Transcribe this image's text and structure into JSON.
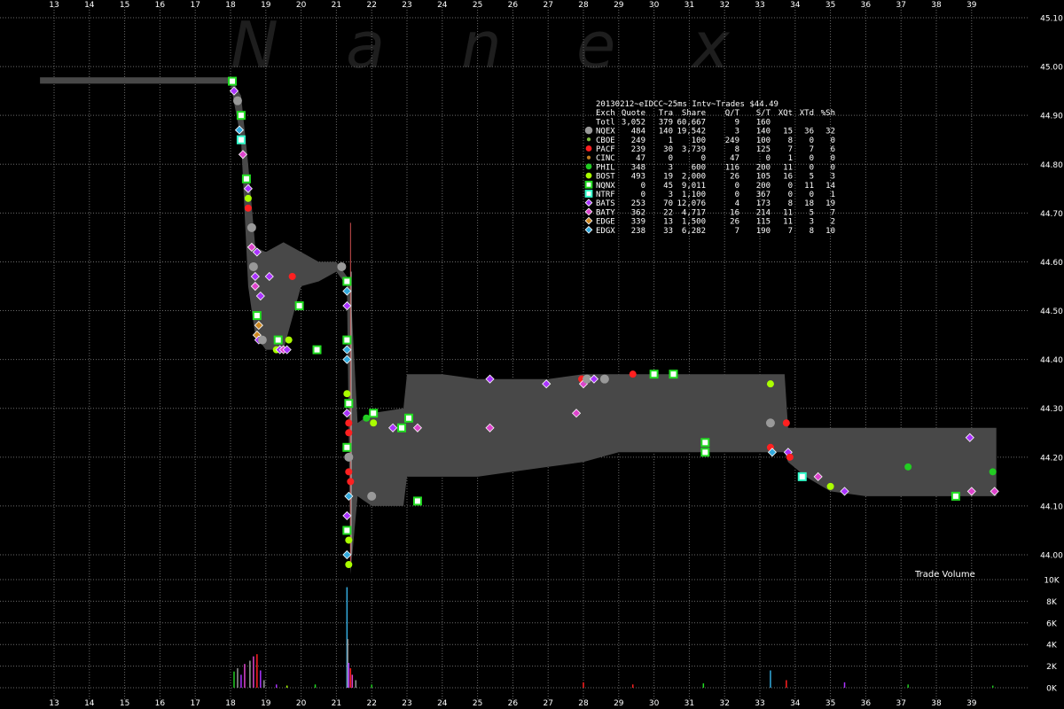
{
  "watermark": [
    "N",
    "a",
    "n",
    "e",
    "x"
  ],
  "legend": {
    "title": "20130212~eIDCC~25ms Intv~Trades $44.49",
    "header": [
      "Exch",
      "Quote",
      "Tra",
      "Share",
      "Q/T",
      "S/T",
      "XQt",
      "XTd",
      "%Sh"
    ],
    "total": [
      "Totl",
      "3,052",
      "379",
      "60,667",
      "9",
      "160",
      "",
      "",
      ""
    ],
    "rows": [
      {
        "name": "NQEX",
        "color": "#999999",
        "marker": "circle-large",
        "values": [
          "484",
          "140",
          "19,542",
          "3",
          "140",
          "15",
          "36",
          "32"
        ]
      },
      {
        "name": "CBOE",
        "color": "#7fbf3f",
        "marker": "circle-small",
        "values": [
          "249",
          "1",
          "100",
          "249",
          "100",
          "8",
          "0",
          "0"
        ]
      },
      {
        "name": "PACF",
        "color": "#ff2020",
        "marker": "circle",
        "values": [
          "239",
          "30",
          "3,739",
          "8",
          "125",
          "7",
          "7",
          "6"
        ]
      },
      {
        "name": "CINC",
        "color": "#c08020",
        "marker": "circle-small",
        "values": [
          "47",
          "0",
          "0",
          "47",
          "0",
          "1",
          "0",
          "0"
        ]
      },
      {
        "name": "PHIL",
        "color": "#22cc22",
        "marker": "circle",
        "values": [
          "348",
          "3",
          "600",
          "116",
          "200",
          "11",
          "0",
          "0"
        ]
      },
      {
        "name": "BOST",
        "color": "#aaff00",
        "marker": "circle",
        "values": [
          "493",
          "19",
          "2,000",
          "26",
          "105",
          "16",
          "5",
          "3"
        ]
      },
      {
        "name": "NQNX",
        "color": "#22dd22",
        "marker": "square",
        "values": [
          "0",
          "45",
          "9,011",
          "0",
          "200",
          "0",
          "11",
          "14"
        ]
      },
      {
        "name": "NTRF",
        "color": "#33ffcc",
        "marker": "square",
        "values": [
          "0",
          "3",
          "1,100",
          "0",
          "367",
          "0",
          "0",
          "1"
        ]
      },
      {
        "name": "BATS",
        "color": "#aa33ff",
        "marker": "diamond",
        "values": [
          "253",
          "70",
          "12,076",
          "4",
          "173",
          "8",
          "18",
          "19"
        ]
      },
      {
        "name": "BATY",
        "color": "#dd44cc",
        "marker": "diamond",
        "values": [
          "362",
          "22",
          "4,717",
          "16",
          "214",
          "11",
          "5",
          "7"
        ]
      },
      {
        "name": "EDGE",
        "color": "#cc8822",
        "marker": "diamond",
        "values": [
          "339",
          "13",
          "1,500",
          "26",
          "115",
          "11",
          "3",
          "2"
        ]
      },
      {
        "name": "EDGX",
        "color": "#33aadd",
        "marker": "diamond",
        "values": [
          "238",
          "33",
          "6,282",
          "7",
          "190",
          "7",
          "8",
          "10"
        ]
      }
    ]
  },
  "volume_label": "Trade Volume",
  "chart_data": {
    "type": "scatter",
    "x_ticks": [
      "13",
      "14",
      "15",
      "16",
      "17",
      "18",
      "19",
      "20",
      "21",
      "22",
      "23",
      "24",
      "25",
      "26",
      "27",
      "28",
      "29",
      "30",
      "31",
      "32",
      "33",
      "34",
      "35",
      "36",
      "37",
      "38",
      "39"
    ],
    "price_ticks": [
      "45.10",
      "45.00",
      "44.90",
      "44.80",
      "44.70",
      "44.60",
      "44.50",
      "44.40",
      "44.30",
      "44.20",
      "44.10",
      "44.00"
    ],
    "volume_ticks": [
      "10K",
      "8K",
      "6K",
      "4K",
      "2K",
      "0K"
    ],
    "ylim_price": [
      43.97,
      45.12
    ],
    "ylim_volume": [
      0,
      10000
    ],
    "grid": true,
    "spread_band": [
      {
        "x": 12.6,
        "bid": 44.965,
        "ask": 44.978
      },
      {
        "x": 18.0,
        "bid": 44.965,
        "ask": 44.978
      },
      {
        "x": 18.3,
        "bid": 44.85,
        "ask": 44.94
      },
      {
        "x": 18.5,
        "bid": 44.55,
        "ask": 44.8
      },
      {
        "x": 18.7,
        "bid": 44.45,
        "ask": 44.63
      },
      {
        "x": 19.0,
        "bid": 44.42,
        "ask": 44.62
      },
      {
        "x": 19.5,
        "bid": 44.42,
        "ask": 44.64
      },
      {
        "x": 20.0,
        "bid": 44.55,
        "ask": 44.62
      },
      {
        "x": 20.5,
        "bid": 44.56,
        "ask": 44.6
      },
      {
        "x": 21.0,
        "bid": 44.58,
        "ask": 44.6
      },
      {
        "x": 21.3,
        "bid": 44.55,
        "ask": 44.57
      },
      {
        "x": 21.4,
        "bid": 43.96,
        "ask": 44.55
      },
      {
        "x": 21.6,
        "bid": 44.12,
        "ask": 44.27
      },
      {
        "x": 22.0,
        "bid": 44.1,
        "ask": 44.29
      },
      {
        "x": 22.9,
        "bid": 44.1,
        "ask": 44.3
      },
      {
        "x": 23.0,
        "bid": 44.16,
        "ask": 44.37
      },
      {
        "x": 24.0,
        "bid": 44.16,
        "ask": 44.37
      },
      {
        "x": 25.0,
        "bid": 44.16,
        "ask": 44.36
      },
      {
        "x": 26.0,
        "bid": 44.17,
        "ask": 44.36
      },
      {
        "x": 27.0,
        "bid": 44.18,
        "ask": 44.36
      },
      {
        "x": 28.0,
        "bid": 44.19,
        "ask": 44.37
      },
      {
        "x": 28.5,
        "bid": 44.2,
        "ask": 44.37
      },
      {
        "x": 29.0,
        "bid": 44.21,
        "ask": 44.37
      },
      {
        "x": 30.0,
        "bid": 44.21,
        "ask": 44.37
      },
      {
        "x": 31.0,
        "bid": 44.21,
        "ask": 44.37
      },
      {
        "x": 32.0,
        "bid": 44.21,
        "ask": 44.37
      },
      {
        "x": 33.0,
        "bid": 44.21,
        "ask": 44.37
      },
      {
        "x": 33.7,
        "bid": 44.21,
        "ask": 44.37
      },
      {
        "x": 33.8,
        "bid": 44.19,
        "ask": 44.26
      },
      {
        "x": 34.3,
        "bid": 44.16,
        "ask": 44.26
      },
      {
        "x": 35.0,
        "bid": 44.13,
        "ask": 44.26
      },
      {
        "x": 36.0,
        "bid": 44.12,
        "ask": 44.26
      },
      {
        "x": 37.0,
        "bid": 44.12,
        "ask": 44.26
      },
      {
        "x": 38.0,
        "bid": 44.12,
        "ask": 44.26
      },
      {
        "x": 39.7,
        "bid": 44.12,
        "ask": 44.26
      }
    ],
    "trades": [
      {
        "x": 18.05,
        "y": 44.97,
        "ex": "NQNX"
      },
      {
        "x": 18.1,
        "y": 44.95,
        "ex": "BATS"
      },
      {
        "x": 18.2,
        "y": 44.93,
        "ex": "NQEX"
      },
      {
        "x": 18.3,
        "y": 44.9,
        "ex": "NQNX"
      },
      {
        "x": 18.25,
        "y": 44.87,
        "ex": "EDGX"
      },
      {
        "x": 18.3,
        "y": 44.85,
        "ex": "NTRF"
      },
      {
        "x": 18.35,
        "y": 44.82,
        "ex": "BATY"
      },
      {
        "x": 18.45,
        "y": 44.77,
        "ex": "NQNX"
      },
      {
        "x": 18.5,
        "y": 44.75,
        "ex": "BATS"
      },
      {
        "x": 18.5,
        "y": 44.73,
        "ex": "BOST"
      },
      {
        "x": 18.5,
        "y": 44.71,
        "ex": "PACF"
      },
      {
        "x": 18.6,
        "y": 44.67,
        "ex": "NQEX"
      },
      {
        "x": 18.6,
        "y": 44.63,
        "ex": "BATY"
      },
      {
        "x": 18.75,
        "y": 44.62,
        "ex": "BATS"
      },
      {
        "x": 18.65,
        "y": 44.59,
        "ex": "NQEX"
      },
      {
        "x": 18.7,
        "y": 44.57,
        "ex": "BATS"
      },
      {
        "x": 18.7,
        "y": 44.55,
        "ex": "BATY"
      },
      {
        "x": 18.85,
        "y": 44.53,
        "ex": "BATS"
      },
      {
        "x": 18.75,
        "y": 44.49,
        "ex": "NQNX"
      },
      {
        "x": 18.8,
        "y": 44.47,
        "ex": "EDGE"
      },
      {
        "x": 18.75,
        "y": 44.45,
        "ex": "EDGE"
      },
      {
        "x": 18.8,
        "y": 44.44,
        "ex": "BATS"
      },
      {
        "x": 18.9,
        "y": 44.44,
        "ex": "NQEX"
      },
      {
        "x": 19.35,
        "y": 44.44,
        "ex": "NQNX"
      },
      {
        "x": 19.65,
        "y": 44.44,
        "ex": "BOST"
      },
      {
        "x": 19.3,
        "y": 44.42,
        "ex": "BOST"
      },
      {
        "x": 19.4,
        "y": 44.42,
        "ex": "BATS"
      },
      {
        "x": 19.5,
        "y": 44.42,
        "ex": "BATY"
      },
      {
        "x": 19.6,
        "y": 44.42,
        "ex": "BATS"
      },
      {
        "x": 19.75,
        "y": 44.57,
        "ex": "PACF"
      },
      {
        "x": 19.95,
        "y": 44.51,
        "ex": "NQNX"
      },
      {
        "x": 19.1,
        "y": 44.57,
        "ex": "BATS"
      },
      {
        "x": 20.45,
        "y": 44.42,
        "ex": "NQNX"
      },
      {
        "x": 21.15,
        "y": 44.59,
        "ex": "NQEX"
      },
      {
        "x": 21.3,
        "y": 44.56,
        "ex": "NQNX"
      },
      {
        "x": 21.3,
        "y": 44.54,
        "ex": "EDGX"
      },
      {
        "x": 21.3,
        "y": 44.51,
        "ex": "BATS"
      },
      {
        "x": 21.3,
        "y": 44.44,
        "ex": "NQNX"
      },
      {
        "x": 21.3,
        "y": 44.42,
        "ex": "EDGX"
      },
      {
        "x": 21.3,
        "y": 44.4,
        "ex": "EDGX"
      },
      {
        "x": 21.3,
        "y": 44.33,
        "ex": "BOST"
      },
      {
        "x": 21.35,
        "y": 44.31,
        "ex": "NQNX"
      },
      {
        "x": 21.3,
        "y": 44.29,
        "ex": "BATS"
      },
      {
        "x": 21.35,
        "y": 44.27,
        "ex": "PACF"
      },
      {
        "x": 21.35,
        "y": 44.25,
        "ex": "PACF"
      },
      {
        "x": 21.3,
        "y": 44.22,
        "ex": "NQNX"
      },
      {
        "x": 21.35,
        "y": 44.2,
        "ex": "NQEX"
      },
      {
        "x": 21.35,
        "y": 44.17,
        "ex": "PACF"
      },
      {
        "x": 21.4,
        "y": 44.15,
        "ex": "PACF"
      },
      {
        "x": 21.35,
        "y": 44.12,
        "ex": "EDGX"
      },
      {
        "x": 21.3,
        "y": 44.08,
        "ex": "BATS"
      },
      {
        "x": 21.3,
        "y": 44.05,
        "ex": "NQNX"
      },
      {
        "x": 21.35,
        "y": 44.03,
        "ex": "BOST"
      },
      {
        "x": 21.3,
        "y": 44.0,
        "ex": "EDGX"
      },
      {
        "x": 21.35,
        "y": 43.98,
        "ex": "BOST"
      },
      {
        "x": 21.85,
        "y": 44.28,
        "ex": "PHIL"
      },
      {
        "x": 22.05,
        "y": 44.29,
        "ex": "NQNX"
      },
      {
        "x": 22.05,
        "y": 44.27,
        "ex": "BOST"
      },
      {
        "x": 22.6,
        "y": 44.26,
        "ex": "BATS"
      },
      {
        "x": 22.85,
        "y": 44.26,
        "ex": "NQNX"
      },
      {
        "x": 23.05,
        "y": 44.28,
        "ex": "NQNX"
      },
      {
        "x": 23.3,
        "y": 44.26,
        "ex": "BATY"
      },
      {
        "x": 22.0,
        "y": 44.12,
        "ex": "NQEX"
      },
      {
        "x": 23.3,
        "y": 44.11,
        "ex": "NQNX"
      },
      {
        "x": 25.35,
        "y": 44.36,
        "ex": "BATS"
      },
      {
        "x": 25.35,
        "y": 44.26,
        "ex": "BATY"
      },
      {
        "x": 26.95,
        "y": 44.35,
        "ex": "BATS"
      },
      {
        "x": 27.8,
        "y": 44.29,
        "ex": "BATY"
      },
      {
        "x": 27.95,
        "y": 44.36,
        "ex": "PACF"
      },
      {
        "x": 28.0,
        "y": 44.35,
        "ex": "BATY"
      },
      {
        "x": 28.1,
        "y": 44.36,
        "ex": "NQEX"
      },
      {
        "x": 28.3,
        "y": 44.36,
        "ex": "BATS"
      },
      {
        "x": 28.6,
        "y": 44.36,
        "ex": "NQEX"
      },
      {
        "x": 29.4,
        "y": 44.37,
        "ex": "PACF"
      },
      {
        "x": 30.0,
        "y": 44.37,
        "ex": "NQNX"
      },
      {
        "x": 30.55,
        "y": 44.37,
        "ex": "NQNX"
      },
      {
        "x": 31.45,
        "y": 44.23,
        "ex": "NQNX"
      },
      {
        "x": 31.45,
        "y": 44.21,
        "ex": "NQNX"
      },
      {
        "x": 33.3,
        "y": 44.35,
        "ex": "BOST"
      },
      {
        "x": 33.3,
        "y": 44.27,
        "ex": "NQEX"
      },
      {
        "x": 33.75,
        "y": 44.27,
        "ex": "PACF"
      },
      {
        "x": 33.3,
        "y": 44.22,
        "ex": "PACF"
      },
      {
        "x": 33.35,
        "y": 44.21,
        "ex": "EDGX"
      },
      {
        "x": 33.8,
        "y": 44.21,
        "ex": "BATS"
      },
      {
        "x": 33.85,
        "y": 44.2,
        "ex": "PACF"
      },
      {
        "x": 34.2,
        "y": 44.16,
        "ex": "NTRF"
      },
      {
        "x": 34.65,
        "y": 44.16,
        "ex": "BATY"
      },
      {
        "x": 35.0,
        "y": 44.14,
        "ex": "BOST"
      },
      {
        "x": 35.4,
        "y": 44.13,
        "ex": "BATS"
      },
      {
        "x": 37.2,
        "y": 44.18,
        "ex": "PHIL"
      },
      {
        "x": 38.55,
        "y": 44.12,
        "ex": "NQNX"
      },
      {
        "x": 38.95,
        "y": 44.24,
        "ex": "BATS"
      },
      {
        "x": 39.0,
        "y": 44.13,
        "ex": "BATY"
      },
      {
        "x": 39.6,
        "y": 44.17,
        "ex": "PHIL"
      },
      {
        "x": 39.65,
        "y": 44.13,
        "ex": "BATY"
      }
    ],
    "volume": [
      {
        "x": 18.1,
        "v": 1500,
        "ex": "PHIL"
      },
      {
        "x": 18.2,
        "v": 1800,
        "ex": "NQEX"
      },
      {
        "x": 18.3,
        "v": 1200,
        "ex": "BATS"
      },
      {
        "x": 18.4,
        "v": 2200,
        "ex": "BATY"
      },
      {
        "x": 18.55,
        "v": 2500,
        "ex": "NQEX"
      },
      {
        "x": 18.65,
        "v": 2900,
        "ex": "BATY"
      },
      {
        "x": 18.75,
        "v": 3100,
        "ex": "PACF"
      },
      {
        "x": 18.85,
        "v": 1600,
        "ex": "BATS"
      },
      {
        "x": 18.95,
        "v": 700,
        "ex": "NQEX"
      },
      {
        "x": 19.3,
        "v": 300,
        "ex": "BATS"
      },
      {
        "x": 19.6,
        "v": 200,
        "ex": "BOST"
      },
      {
        "x": 20.4,
        "v": 300,
        "ex": "NQNX"
      },
      {
        "x": 21.3,
        "v": 9300,
        "ex": "EDGX"
      },
      {
        "x": 21.32,
        "v": 4500,
        "ex": "NQEX"
      },
      {
        "x": 21.35,
        "v": 2300,
        "ex": "BATS"
      },
      {
        "x": 21.4,
        "v": 1800,
        "ex": "PACF"
      },
      {
        "x": 21.45,
        "v": 1200,
        "ex": "BATY"
      },
      {
        "x": 21.55,
        "v": 700,
        "ex": "NQEX"
      },
      {
        "x": 22.0,
        "v": 300,
        "ex": "PHIL"
      },
      {
        "x": 28.0,
        "v": 500,
        "ex": "PACF"
      },
      {
        "x": 29.4,
        "v": 300,
        "ex": "PACF"
      },
      {
        "x": 31.4,
        "v": 400,
        "ex": "NQNX"
      },
      {
        "x": 33.3,
        "v": 1600,
        "ex": "EDGX"
      },
      {
        "x": 33.75,
        "v": 700,
        "ex": "PACF"
      },
      {
        "x": 35.4,
        "v": 500,
        "ex": "BATS"
      },
      {
        "x": 37.2,
        "v": 300,
        "ex": "PHIL"
      },
      {
        "x": 39.6,
        "v": 200,
        "ex": "PHIL"
      }
    ]
  }
}
